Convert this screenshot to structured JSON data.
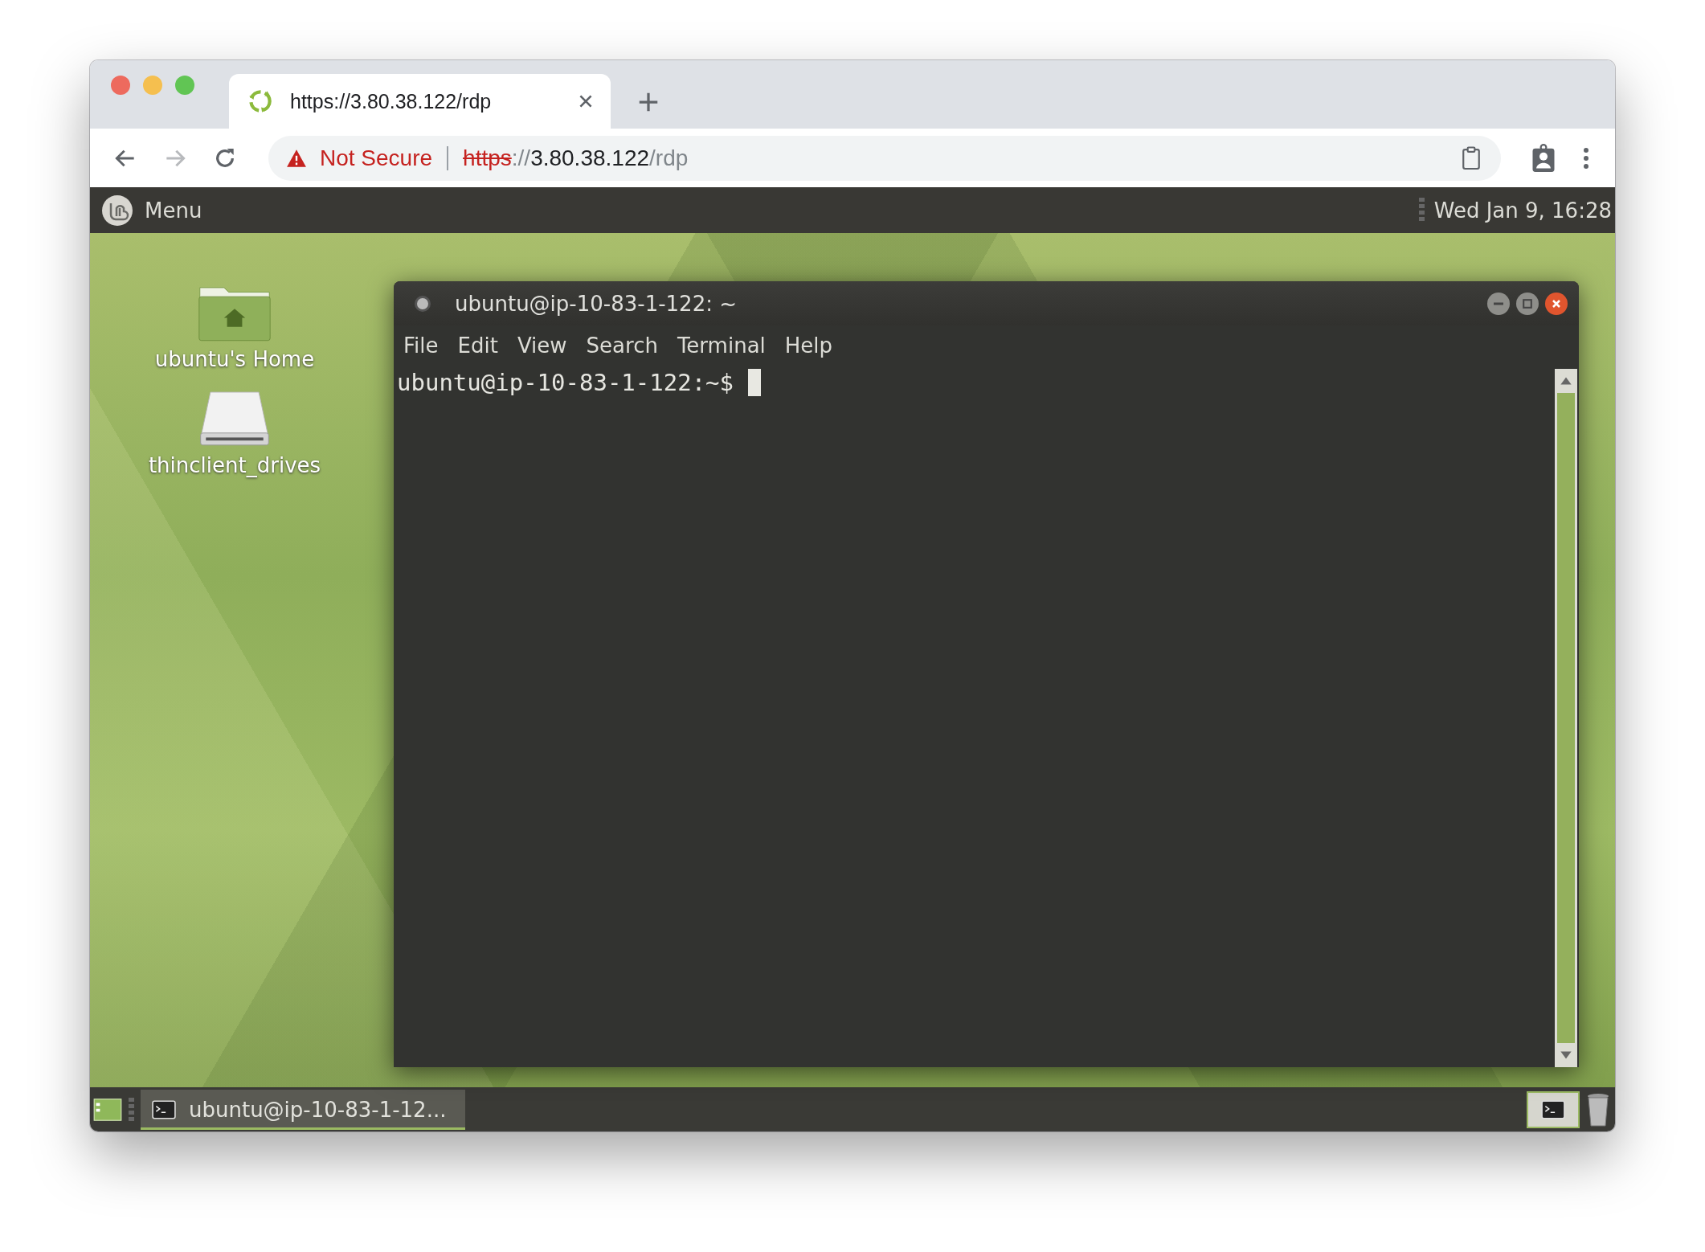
{
  "browser": {
    "tab": {
      "title": "https://3.80.38.122/rdp"
    },
    "address_bar": {
      "security": "Not Secure",
      "scheme": "https",
      "separator": "://",
      "host": "3.80.38.122",
      "path": "/rdp"
    }
  },
  "panel": {
    "menu": "Menu",
    "clock": "Wed Jan 9, 16:28"
  },
  "desktop_icons": [
    {
      "kind": "folder",
      "label": "ubuntu's Home"
    },
    {
      "kind": "drive",
      "label": "thinclient_drives"
    }
  ],
  "terminal": {
    "title": "ubuntu@ip-10-83-1-122: ~",
    "menu": [
      "File",
      "Edit",
      "View",
      "Search",
      "Terminal",
      "Help"
    ],
    "prompt": "ubuntu@ip-10-83-1-122:~$"
  },
  "taskbar": {
    "tasks": [
      {
        "label": "ubuntu@ip-10-83-1-12...",
        "selected": true
      }
    ]
  }
}
